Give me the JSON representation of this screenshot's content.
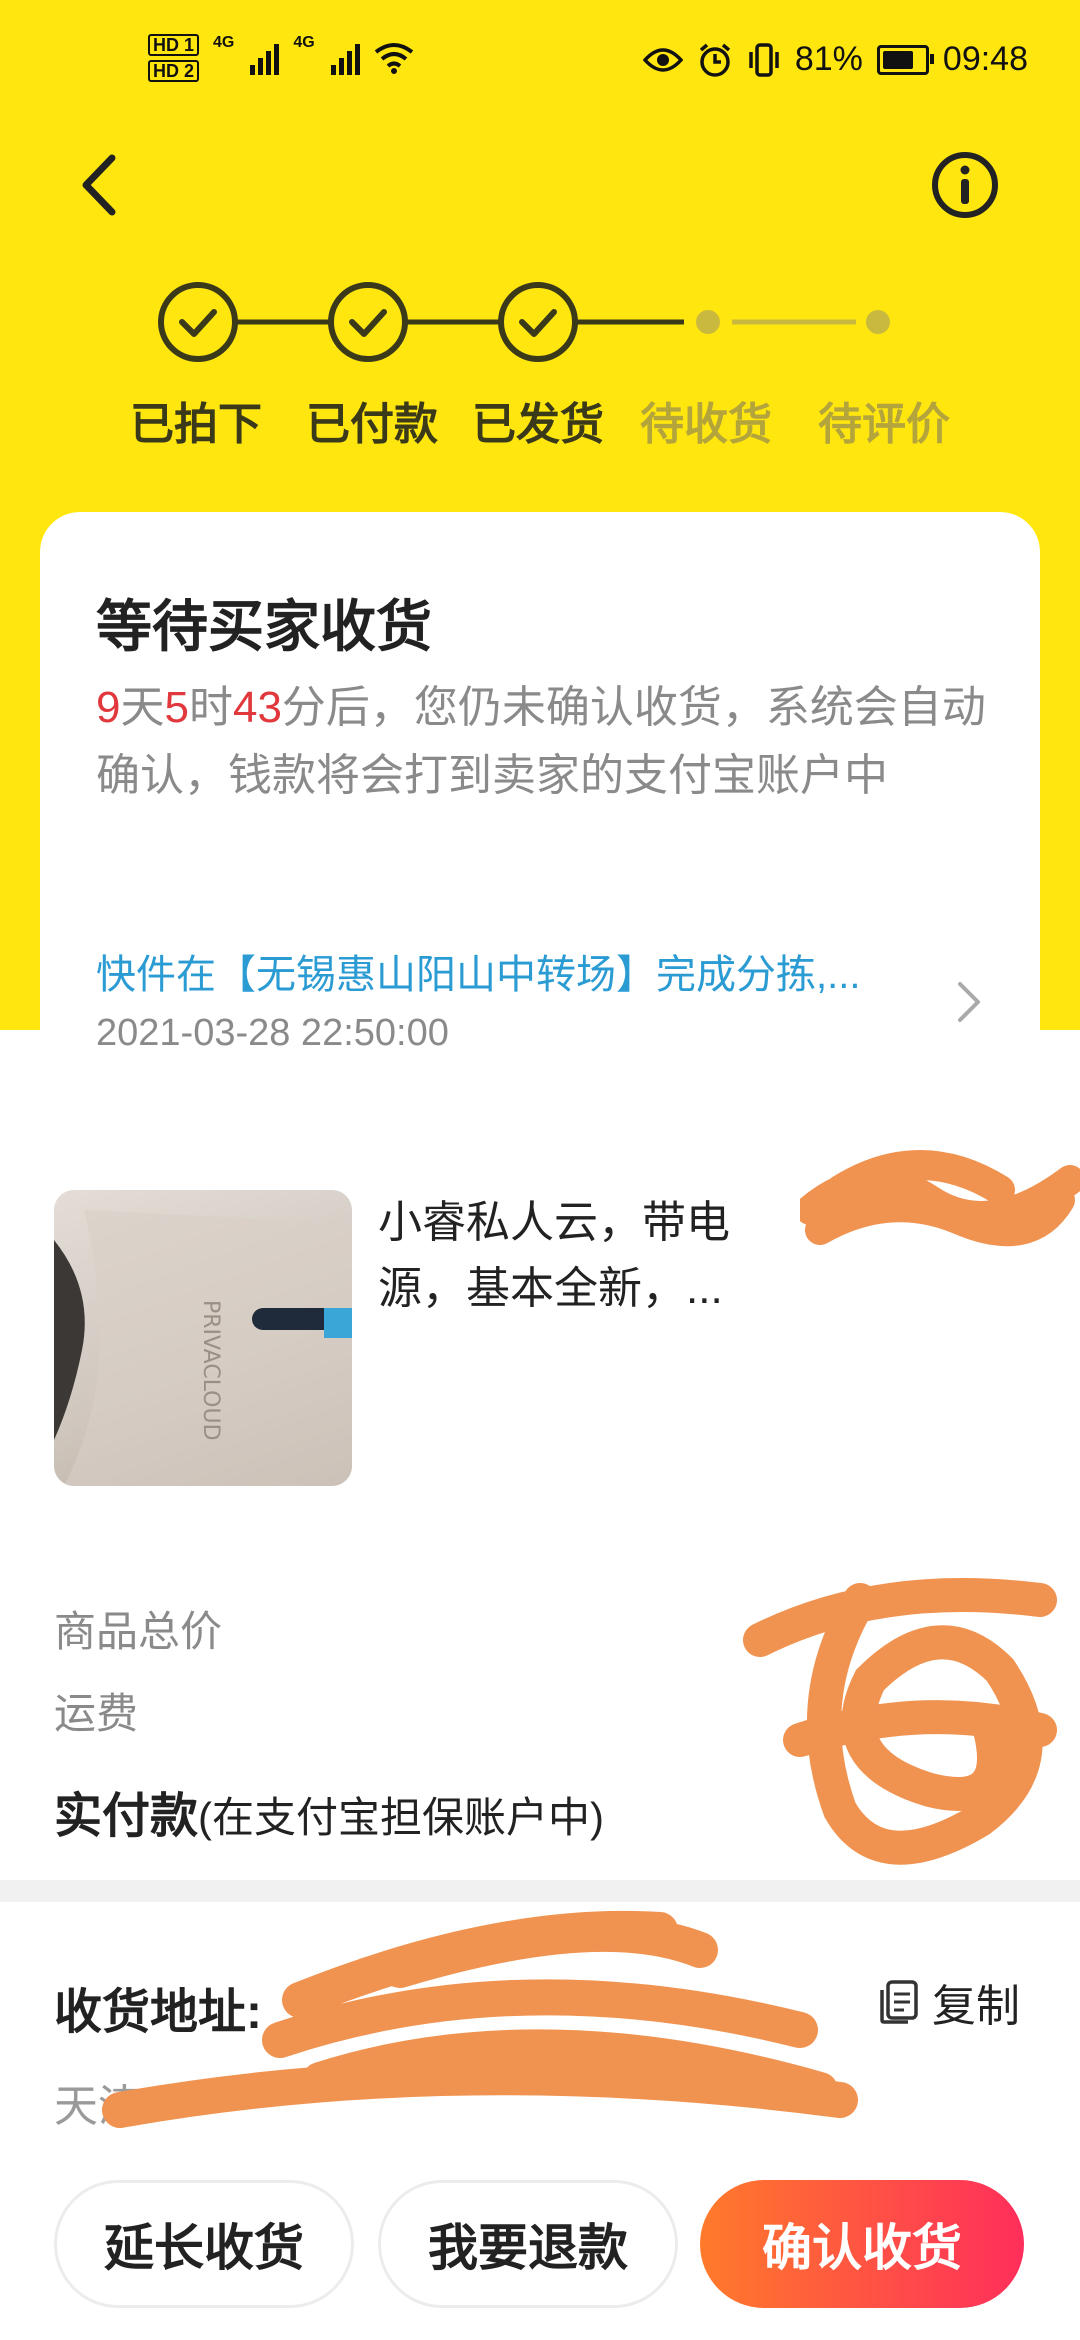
{
  "status_bar": {
    "hd1": "HD 1",
    "hd2": "HD 2",
    "net1": "4G",
    "net2": "4G",
    "battery_pct": "81%",
    "time": "09:48"
  },
  "steps": [
    {
      "label": "已拍下",
      "done": true
    },
    {
      "label": "已付款",
      "done": true
    },
    {
      "label": "已发货",
      "done": true
    },
    {
      "label": "待收货",
      "done": false
    },
    {
      "label": "待评价",
      "done": false
    }
  ],
  "status_card": {
    "title": "等待买家收货",
    "days": "9",
    "day_unit": "天",
    "hours": "5",
    "hour_unit": "时",
    "minutes": "43",
    "desc_rest": "分后，您仍未确认收货，系统会自动确认，钱款将会打到卖家的支付宝账户中",
    "logistics": "快件在【无锡惠山阳山中转场】完成分拣,...",
    "logistics_time": "2021-03-28 22:50:00"
  },
  "product": {
    "title": "小睿私人云，带电源，基本全新，..."
  },
  "price": {
    "total_label": "商品总价",
    "shipping_label": "运费",
    "paid_label": "实付款",
    "paid_note": "(在支付宝担保账户中)"
  },
  "address": {
    "label": "收货地址:",
    "copy_label": "复制",
    "line": "天津"
  },
  "actions": {
    "extend": "延长收货",
    "refund": "我要退款",
    "confirm": "确认收货"
  },
  "colors": {
    "brand_yellow": "#ffe60f",
    "countdown_red": "#e0383c",
    "link_blue": "#2a9bd3",
    "primary_gradient_start": "#ff7a2a",
    "primary_gradient_end": "#ff2e5b"
  }
}
